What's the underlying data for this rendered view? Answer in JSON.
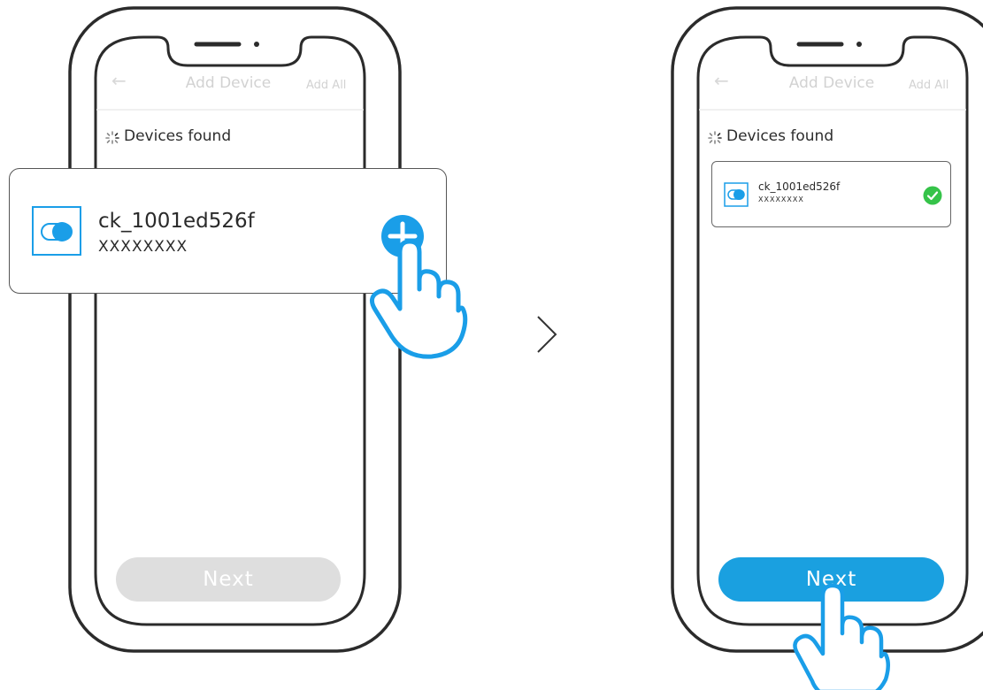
{
  "step1": {
    "header": {
      "back_icon": "arrow-left-icon",
      "title": "Add Device",
      "add_all": "Add All"
    },
    "status": {
      "icon": "loading-spinner-icon",
      "text": "Devices found"
    },
    "device": {
      "icon": "switch-toggle-icon",
      "name": "ck_1001ed526f",
      "subtitle": "XXXXXXXX",
      "action_icon": "plus-circle-icon"
    },
    "next_button": {
      "label": "Next",
      "state": "disabled",
      "color": "#dedede"
    }
  },
  "separator": {
    "icon": "chevron-right-icon",
    "glyph": ">"
  },
  "step2": {
    "header": {
      "back_icon": "arrow-left-icon",
      "title": "Add Device",
      "add_all": "Add All"
    },
    "status": {
      "icon": "loading-spinner-icon",
      "text": "Devices found"
    },
    "device": {
      "icon": "switch-toggle-icon",
      "name": "ck_1001ed526f",
      "subtitle": "XXXXXXXX",
      "status_icon": "check-circle-icon",
      "status_color": "#35c349"
    },
    "next_button": {
      "label": "Next",
      "state": "enabled",
      "color": "#1aa0e0"
    }
  },
  "colors": {
    "accent": "#1a9ee8",
    "outline": "#2b2b2b",
    "success": "#35c349"
  }
}
